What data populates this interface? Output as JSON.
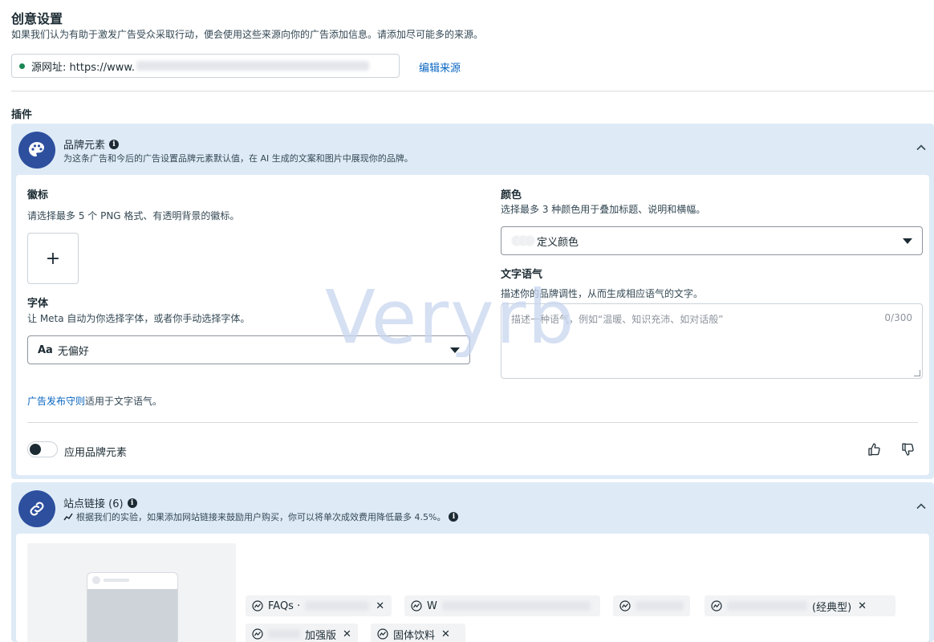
{
  "header": {
    "title": "创意设置",
    "subtitle": "如果我们认为有助于激发广告受众采取行动，便会使用这些来源向你的广告添加信息。请添加尽可能多的来源。"
  },
  "source": {
    "label": "源网址: https://www.",
    "edit_label": "编辑来源",
    "status_color": "#1a8754"
  },
  "plugins_label": "插件",
  "brand_panel": {
    "title": "品牌元素",
    "desc": "为这条广告和今后的广告设置品牌元素默认值，在 AI 生成的文案和图片中展现你的品牌。",
    "icon": "palette-icon",
    "logo": {
      "title": "徽标",
      "hint": "请选择最多 5 个 PNG 格式、有透明背景的徽标。",
      "add": "+"
    },
    "font": {
      "title": "字体",
      "hint": "让 Meta 自动为你选择字体，或者你手动选择字体。",
      "prefix": "Aa",
      "value": "无偏好"
    },
    "color": {
      "title": "颜色",
      "hint": "选择最多 3 种颜色用于叠加标题、说明和横幅。",
      "value": "定义颜色"
    },
    "tone": {
      "title": "文字语气",
      "hint": "描述你的品牌调性，从而生成相应语气的文字。",
      "placeholder": "描述一种语气，例如“温暖、知识充沛、如对话般”",
      "counter": "0/300"
    },
    "rules_link": "广告发布守则",
    "rules_suffix": "适用于文字语气。",
    "toggle_label": "应用品牌元素",
    "toggle_on": false
  },
  "site_panel": {
    "title": "站点链接 (6)",
    "desc": "根据我们的实验，如果添加网站链接来鼓励用户购买，你可以将单次成效费用降低最多 4.5%。",
    "icon": "link-icon",
    "chips": [
      {
        "label": "FAQs ·",
        "removable": true
      },
      {
        "label": "W",
        "removable": false
      },
      {
        "label": "",
        "removable": false
      },
      {
        "label": "(经典型)",
        "removable": true
      },
      {
        "label": "加强版",
        "removable": true
      },
      {
        "label": "固体饮料",
        "removable": true
      }
    ]
  },
  "colors": {
    "accent": "#2d4f9e",
    "link": "#0a66c2",
    "panel_bg": "#deebf7"
  }
}
